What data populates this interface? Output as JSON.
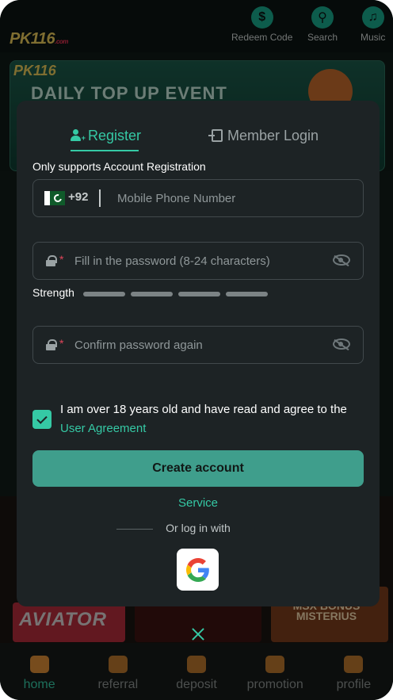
{
  "header": {
    "logo": "PK116",
    "logo_suffix": ".com",
    "actions": [
      {
        "label": "Redeem Code",
        "icon": "redeem-icon"
      },
      {
        "label": "Search",
        "icon": "search-icon"
      },
      {
        "label": "Music",
        "icon": "music-icon"
      }
    ]
  },
  "banner": {
    "logo": "PK116",
    "title": "DAILY TOP UP EVENT"
  },
  "games": {
    "tile1": "AVIATOR",
    "tile3": "MSX BONUS MISTERIUS"
  },
  "bottom_nav": [
    {
      "label": "home",
      "active": true
    },
    {
      "label": "referral",
      "active": false
    },
    {
      "label": "deposit",
      "active": false
    },
    {
      "label": "promotion",
      "active": false
    },
    {
      "label": "profile",
      "active": false
    }
  ],
  "modal": {
    "tabs": {
      "register": "Register",
      "login": "Member Login"
    },
    "note": "Only supports Account Registration",
    "phone": {
      "country_code": "+92",
      "placeholder": "Mobile Phone Number"
    },
    "password": {
      "required_mark": "*",
      "placeholder": "Fill in the password (8-24 characters)"
    },
    "strength_label": "Strength",
    "confirm": {
      "required_mark": "*",
      "placeholder": "Confirm password again"
    },
    "agreement": {
      "text": "I am over 18 years old and have read and agree to the ",
      "link": "User Agreement",
      "checked": true
    },
    "create_button": "Create account",
    "service": "Service",
    "or_login": "Or log in with",
    "social": [
      "google-icon"
    ]
  },
  "colors": {
    "accent": "#35c9a5",
    "button": "#3f9e8c",
    "modal_bg": "#1d2325",
    "required": "#e0455a"
  }
}
